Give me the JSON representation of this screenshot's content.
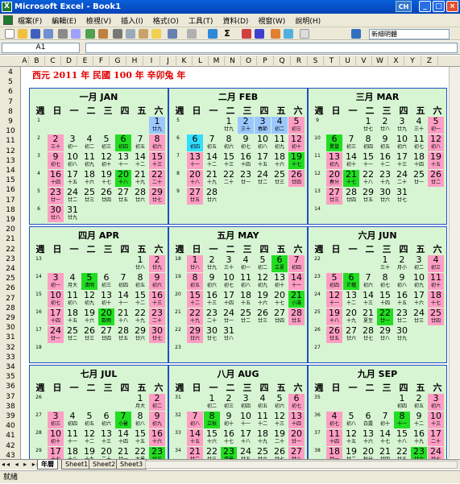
{
  "window": {
    "title": "Microsoft Excel - Book1",
    "ime_label": "CH",
    "min": "_",
    "max": "□",
    "close": "×"
  },
  "menu": [
    "檔案(F)",
    "編輯(E)",
    "檢視(V)",
    "插入(I)",
    "格式(O)",
    "工具(T)",
    "資料(D)",
    "視窗(W)",
    "說明(H)"
  ],
  "toolbar": {
    "font": "新細明體",
    "sigma": "Σ"
  },
  "formula": {
    "namebox": "A1",
    "fx": ""
  },
  "columns": [
    "A",
    "B",
    "C",
    "D",
    "E",
    "F",
    "G",
    "H",
    "I",
    "J",
    "K",
    "L",
    "M",
    "N",
    "O",
    "P",
    "Q",
    "R",
    "S",
    "T",
    "U",
    "V",
    "W",
    "X",
    "Y",
    "Z"
  ],
  "rows": [
    "4",
    "5",
    "6",
    "7",
    "8",
    "9",
    "10",
    "11",
    "12",
    "13",
    "14",
    "15",
    "16",
    "17",
    "18",
    "19",
    "20",
    "21",
    "22",
    "23",
    "24",
    "25",
    "26",
    "27",
    "28",
    "29",
    "30",
    "31",
    "32",
    "33",
    "34",
    "35",
    "36",
    "37",
    "38",
    "39",
    "40",
    "41",
    "42",
    "43"
  ],
  "banner": "西元 2011 年  民國 100 年  辛卯兔 年",
  "weekdays": [
    "週",
    "日",
    "一",
    "二",
    "三",
    "四",
    "五",
    "六"
  ],
  "months": [
    {
      "title": "一月 JAN",
      "start": 6,
      "days": 31,
      "lunar": [
        "廿九",
        "三十",
        "初一",
        "初二",
        "初三",
        "初四",
        "初五",
        "初六",
        "初七",
        "初八",
        "初九",
        "初十",
        "十一",
        "十二",
        "十三",
        "十四",
        "十五",
        "十六",
        "十七",
        "十八",
        "十九",
        "二十",
        "廿一",
        "廿二",
        "廿三",
        "廿四",
        "廿五",
        "廿六",
        "廿七",
        "廿八",
        "廿九"
      ],
      "weeks": [
        "1",
        "2",
        "3",
        "4",
        "5",
        "6"
      ]
    },
    {
      "title": "二月 FEB",
      "start": 2,
      "days": 28,
      "lunar": [
        "廿九",
        "三十",
        "春節",
        "初二",
        "初三",
        "初四",
        "初五",
        "初六",
        "初七",
        "初八",
        "初九",
        "初十",
        "十一",
        "十二",
        "十三",
        "十四",
        "十五",
        "十六",
        "十七",
        "十八",
        "十九",
        "二十",
        "廿一",
        "廿二",
        "廿三",
        "廿四",
        "廿五",
        "廿六"
      ],
      "weeks": [
        "5",
        "6",
        "7",
        "8",
        "9"
      ]
    },
    {
      "title": "三月 MAR",
      "start": 2,
      "days": 31,
      "lunar": [
        "廿七",
        "廿八",
        "廿九",
        "三十",
        "初一",
        "驚蟄",
        "初三",
        "初四",
        "初五",
        "初六",
        "初七",
        "初八",
        "初九",
        "初十",
        "十一",
        "十二",
        "十三",
        "十四",
        "十五",
        "春分",
        "十七",
        "十八",
        "十九",
        "二十",
        "廿一",
        "廿二",
        "廿三",
        "廿四",
        "廿五",
        "廿六",
        "廿七"
      ],
      "weeks": [
        "9",
        "10",
        "11",
        "12",
        "13",
        "14"
      ]
    },
    {
      "title": "四月 APR",
      "start": 5,
      "days": 30,
      "lunar": [
        "廿八",
        "廿九",
        "初一",
        "月大",
        "清明",
        "初三",
        "初四",
        "初五",
        "初六",
        "初七",
        "初八",
        "初九",
        "初十",
        "十一",
        "十二",
        "十三",
        "十四",
        "十五",
        "十六",
        "穀雨",
        "十八",
        "十九",
        "二十",
        "廿一",
        "廿二",
        "廿三",
        "廿四",
        "廿五",
        "廿六",
        "廿七"
      ],
      "weeks": [
        "13",
        "14",
        "15",
        "16",
        "17",
        "18"
      ]
    },
    {
      "title": "五月 MAY",
      "start": 0,
      "days": 31,
      "lunar": [
        "廿八",
        "廿九",
        "三十",
        "初一",
        "初二",
        "立夏",
        "初四",
        "初五",
        "初六",
        "初七",
        "初八",
        "初九",
        "初十",
        "十一",
        "十二",
        "十三",
        "十四",
        "十五",
        "十六",
        "十七",
        "小滿",
        "十九",
        "二十",
        "廿一",
        "廿二",
        "廿三",
        "廿四",
        "廿五",
        "廿六",
        "廿七",
        "廿八"
      ],
      "weeks": [
        "18",
        "19",
        "20",
        "21",
        "22",
        "23"
      ]
    },
    {
      "title": "六月 JUN",
      "start": 3,
      "days": 30,
      "lunar": [
        "三十",
        "月小",
        "初二",
        "初三",
        "初四",
        "芒種",
        "初六",
        "初七",
        "初八",
        "初九",
        "初十",
        "十一",
        "十二",
        "十三",
        "十四",
        "十五",
        "十六",
        "十七",
        "十八",
        "十九",
        "夏至",
        "廿一",
        "廿二",
        "廿三",
        "廿四",
        "廿五",
        "廿六",
        "廿七",
        "廿八",
        "廿九"
      ],
      "weeks": [
        "22",
        "23",
        "24",
        "25",
        "26",
        "27"
      ]
    },
    {
      "title": "七月 JUL",
      "start": 5,
      "days": 31,
      "lunar": [
        "月大",
        "初二",
        "初三",
        "初四",
        "初五",
        "初六",
        "小暑",
        "初八",
        "初九",
        "初十",
        "十一",
        "十二",
        "十三",
        "十四",
        "十五",
        "十六",
        "十七",
        "十八",
        "十九",
        "二十",
        "廿一",
        "大暑",
        "廿三",
        "廿四",
        "廿五",
        "廿六",
        "廿七",
        "廿八",
        "廿九",
        "三十",
        "初一"
      ],
      "weeks": [
        "26",
        "27",
        "28",
        "29",
        "30",
        "31"
      ]
    },
    {
      "title": "八月 AUG",
      "start": 1,
      "days": 31,
      "lunar": [
        "初二",
        "初三",
        "初四",
        "初五",
        "初六",
        "初七",
        "初八",
        "立秋",
        "初十",
        "十一",
        "十二",
        "十三",
        "十四",
        "十五",
        "十六",
        "十七",
        "十八",
        "十九",
        "二十",
        "廿一",
        "廿二",
        "廿三",
        "處暑",
        "廿五",
        "廿六",
        "廿七",
        "廿八",
        "廿九",
        "初一",
        "初二",
        "初三"
      ],
      "weeks": [
        "31",
        "32",
        "33",
        "34",
        "35",
        "36"
      ]
    },
    {
      "title": "九月 SEP",
      "start": 4,
      "days": 30,
      "lunar": [
        "初四",
        "初五",
        "初六",
        "初七",
        "初八",
        "白露",
        "初十",
        "十一",
        "十二",
        "十三",
        "十四",
        "十五",
        "十六",
        "十七",
        "十八",
        "十九",
        "二十",
        "廿一",
        "廿二",
        "秋分",
        "廿四",
        "廿五",
        "廿六",
        "廿七",
        "廿八",
        "廿九",
        "三十",
        "初一",
        "初二",
        "初三"
      ],
      "weeks": [
        "35",
        "36",
        "37",
        "38",
        "39",
        "40"
      ]
    }
  ],
  "sheets": [
    "年曆",
    "Sheet1",
    "Sheet2",
    "Sheet3"
  ],
  "status": "就緒"
}
